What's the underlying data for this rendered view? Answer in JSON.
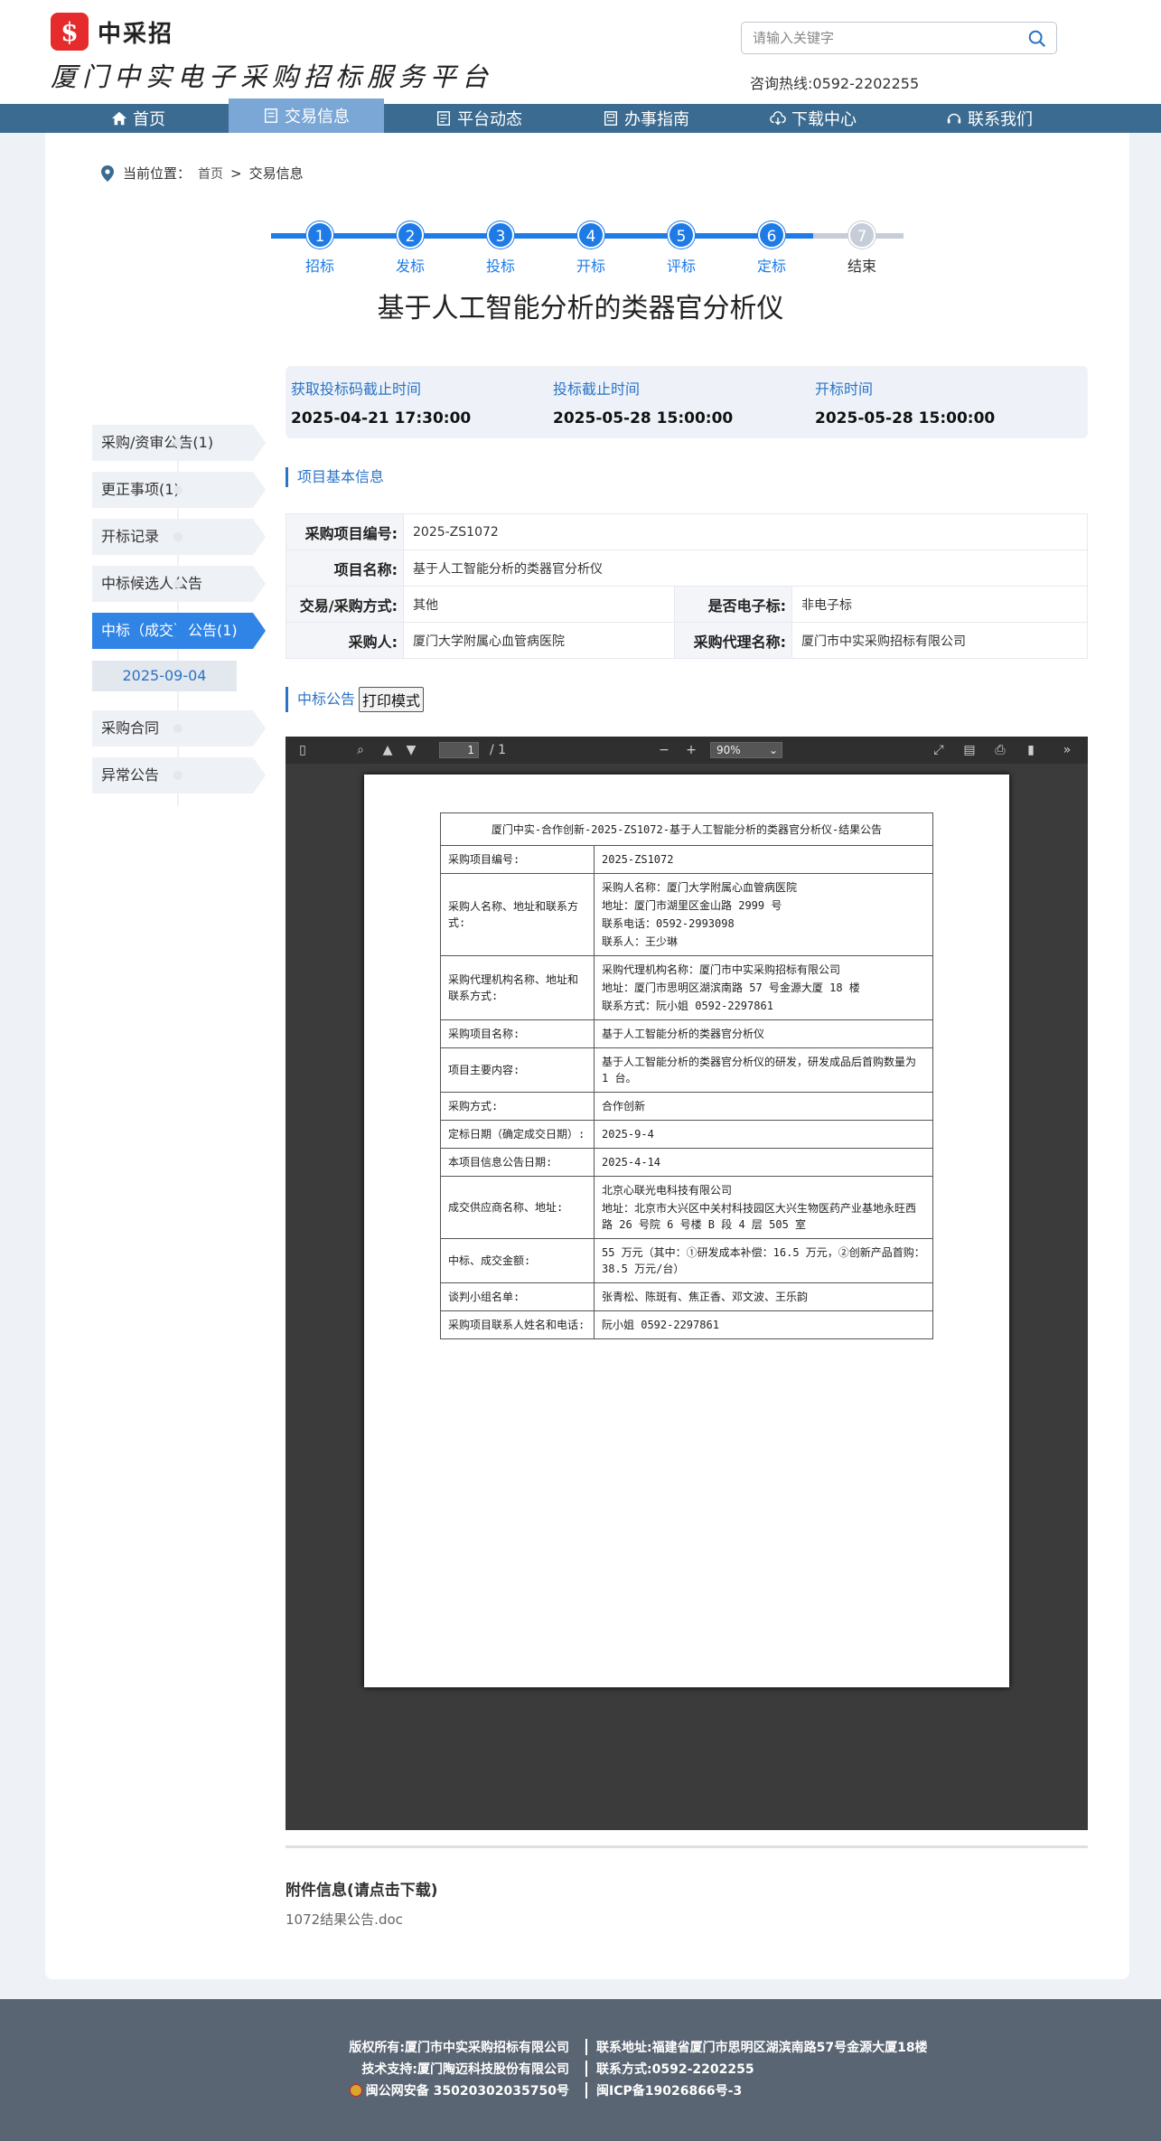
{
  "header": {
    "logo_mark": "$",
    "logo_text": "中采招",
    "slogan": "厦门中实电子采购招标服务平台",
    "search_placeholder": "请输入关键字",
    "hotline": "咨询热线:0592-2202255"
  },
  "nav": [
    "首页",
    "交易信息",
    "平台动态",
    "办事指南",
    "下载中心",
    "联系我们"
  ],
  "nav_active": "交易信息",
  "breadcrumb": {
    "label": "当前位置：",
    "home": "首页",
    "sep": ">",
    "current": "交易信息"
  },
  "steps": [
    {
      "num": "1",
      "label": "招标",
      "done": true
    },
    {
      "num": "2",
      "label": "发标",
      "done": true
    },
    {
      "num": "3",
      "label": "投标",
      "done": true
    },
    {
      "num": "4",
      "label": "开标",
      "done": true
    },
    {
      "num": "5",
      "label": "评标",
      "done": true
    },
    {
      "num": "6",
      "label": "定标",
      "done": true
    },
    {
      "num": "7",
      "label": "结束",
      "done": false
    }
  ],
  "title": "基于人工智能分析的类器官分析仪",
  "times": [
    {
      "label": "获取投标码截止时间",
      "value": "2025-04-21 17:30:00"
    },
    {
      "label": "投标截止时间",
      "value": "2025-05-28 15:00:00"
    },
    {
      "label": "开标时间",
      "value": "2025-05-28 15:00:00"
    }
  ],
  "sidebar": {
    "items": [
      "采购/资审公告(1)",
      "更正事项(1)",
      "开标记录",
      "中标候选人公告",
      "中标（成交）公告(1)"
    ],
    "active": "中标（成交）公告(1)",
    "sub_date": "2025-09-04",
    "items_after": [
      "采购合同",
      "异常公告"
    ]
  },
  "basic_info": {
    "section_title": "项目基本信息",
    "project_no_label": "采购项目编号:",
    "project_no": "2025-ZS1072",
    "project_name_label": "项目名称:",
    "project_name": "基于人工智能分析的类器官分析仪",
    "method_label": "交易/采购方式:",
    "method": "其他",
    "electronic_label": "是否电子标:",
    "electronic": "非电子标",
    "buyer_label": "采购人:",
    "buyer": "厦门大学附属心血管病医院",
    "agent_label": "采购代理名称:",
    "agent": "厦门市中实采购招标有限公司"
  },
  "notice": {
    "section_title": "中标公告",
    "print_label": "打印模式"
  },
  "pdf": {
    "page": "1",
    "page_total": "/ 1",
    "zoom": "90%"
  },
  "doc": {
    "heading": "厦门中实-合作创新-2025-ZS1072-基于人工智能分析的类器官分析仪-结果公告",
    "rows": [
      {
        "k": "采购项目编号:",
        "v": [
          "2025-ZS1072"
        ]
      },
      {
        "k": "采购人名称、地址和联系方式:",
        "v": [
          "采购人名称：厦门大学附属心血管病医院",
          "地址：厦门市湖里区金山路 2999 号",
          "联系电话：0592-2993098",
          "联系人：王少琳"
        ]
      },
      {
        "k": "采购代理机构名称、地址和联系方式:",
        "v": [
          "采购代理机构名称：厦门市中实采购招标有限公司",
          "地址：厦门市思明区湖滨南路 57 号金源大厦 18 楼",
          "联系方式：阮小姐  0592-2297861"
        ]
      },
      {
        "k": "采购项目名称:",
        "v": [
          "基于人工智能分析的类器官分析仪"
        ]
      },
      {
        "k": "项目主要内容:",
        "v": [
          "基于人工智能分析的类器官分析仪的研发，研发成品后首购数量为 1 台。"
        ]
      },
      {
        "k": "采购方式:",
        "v": [
          "合作创新"
        ]
      },
      {
        "k": "定标日期（确定成交日期）:",
        "v": [
          "2025-9-4"
        ]
      },
      {
        "k": "本项目信息公告日期:",
        "v": [
          "2025-4-14"
        ]
      },
      {
        "k": "成交供应商名称、地址:",
        "v": [
          "北京心联光电科技有限公司",
          "地址：北京市大兴区中关村科技园区大兴生物医药产业基地永旺西路 26 号院 6 号楼 B 段 4 层 505 室"
        ]
      },
      {
        "k": "中标、成交金额:",
        "v": [
          "55 万元（其中：①研发成本补偿：16.5 万元，②创新产品首购：38.5 万元/台）"
        ]
      },
      {
        "k": "谈判小组名单:",
        "v": [
          "张青松、陈斑有、焦正香、邓文波、王乐韵"
        ]
      },
      {
        "k": "采购项目联系人姓名和电话:",
        "v": [
          "阮小姐 0592-2297861"
        ]
      }
    ]
  },
  "attachments": {
    "title": "附件信息(请点击下载)",
    "file": "1072结果公告.doc"
  },
  "footer": {
    "copyright": "版权所有:厦门市中实采购招标有限公司",
    "address": "联系地址:福建省厦门市思明区湖滨南路57号金源大厦18楼",
    "tech": "技术支持:厦门陶迈科技股份有限公司",
    "contact": "联系方式:0592-2202255",
    "police": "闽公网安备 35020302035750号",
    "icp": "闽ICP备19026866号-3"
  },
  "colors": {
    "nav": "#3b6b90",
    "accent": "#1e7be6",
    "footer": "#5a6573"
  }
}
